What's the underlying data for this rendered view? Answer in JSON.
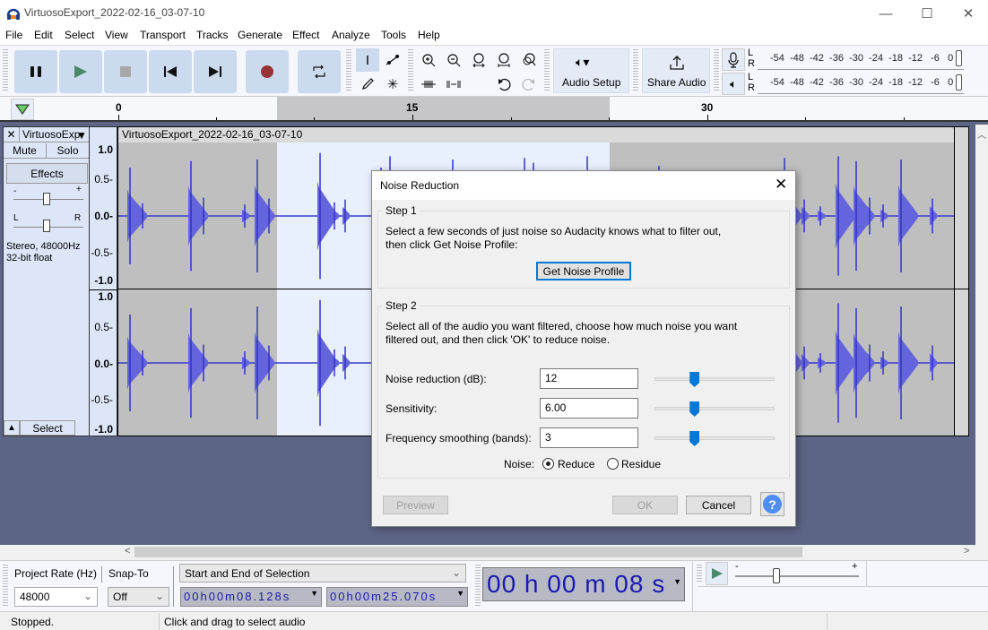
{
  "window": {
    "title": "VirtuosoExport_2022-02-16_03-07-10",
    "minimize": "—",
    "maximize": "☐",
    "close": "✕"
  },
  "menu": [
    "File",
    "Edit",
    "Select",
    "View",
    "Transport",
    "Tracks",
    "Generate",
    "Effect",
    "Analyze",
    "Tools",
    "Help"
  ],
  "toolbar": {
    "audio_setup_label": "Audio Setup",
    "share_audio_label": "Share Audio",
    "meter_scale": "-54  -48  -42  -36  -30  -24  -18  -12   -6   0",
    "meter_l": "L",
    "meter_r": "R"
  },
  "ruler": {
    "ticks": [
      "0",
      "15",
      "30"
    ]
  },
  "track": {
    "name": "VirtuosoExp",
    "close": "✕",
    "mute": "Mute",
    "solo": "Solo",
    "effects": "Effects",
    "gain_minus": "-",
    "gain_plus": "+",
    "pan_l": "L",
    "pan_r": "R",
    "info_line1": "Stereo, 48000Hz",
    "info_line2": "32-bit float",
    "select": "Select",
    "clip_title": "VirtuosoExport_2022-02-16_03-07-10",
    "vruler": [
      "1.0",
      "0.5-",
      "0.0-",
      "-0.5-",
      "-1.0"
    ]
  },
  "dialog": {
    "title": "Noise Reduction",
    "step1_label": "Step 1",
    "step1_line1": "Select a few seconds of just noise so Audacity knows what to filter out,",
    "step1_line2": "then click Get Noise Profile:",
    "get_profile": "Get Noise Profile",
    "step2_label": "Step 2",
    "step2_line1": "Select all of the audio you want filtered, choose how much noise you want",
    "step2_line2": "filtered out, and then click 'OK' to reduce noise.",
    "fields": [
      {
        "label": "Noise reduction (dB):",
        "value": "12",
        "slider": 0.33
      },
      {
        "label": "Sensitivity:",
        "value": "6.00",
        "slider": 0.33
      },
      {
        "label": "Frequency smoothing (bands):",
        "value": "3",
        "slider": 0.33
      }
    ],
    "noise_label": "Noise:",
    "reduce": "Reduce",
    "residue": "Residue",
    "preview": "Preview",
    "ok": "OK",
    "cancel": "Cancel",
    "help": "?"
  },
  "bottom": {
    "project_rate_label": "Project Rate (Hz)",
    "project_rate": "48000",
    "snap_label": "Snap-To",
    "snap": "Off",
    "selection_mode": "Start and End of Selection",
    "sel_start": "00h00m08.128s",
    "sel_end": "00h00m25.070s",
    "time": "00 h 00 m 08 s",
    "speed_minus": "-",
    "speed_plus": "+"
  },
  "status": {
    "state": "Stopped.",
    "hint": "Click and drag to select audio"
  }
}
